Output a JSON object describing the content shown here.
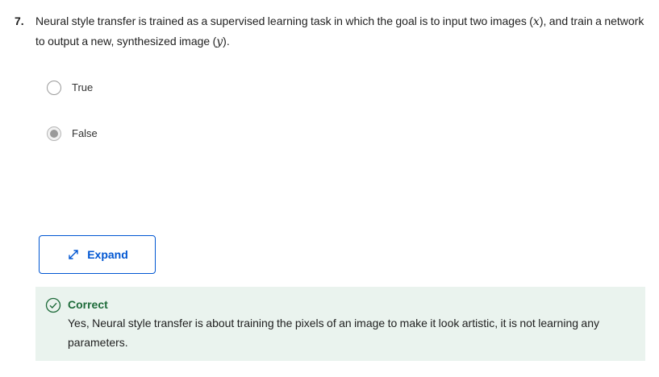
{
  "question": {
    "number": "7.",
    "text_part1": "Neural style transfer is trained as a supervised learning task in which the goal is to input two images (",
    "var_x": "x",
    "text_part2": "), and train a network to output a new, synthesized image (",
    "var_y": "y",
    "text_part3": ")."
  },
  "options": [
    {
      "label": "True",
      "selected": false
    },
    {
      "label": "False",
      "selected": true
    }
  ],
  "expand_button": {
    "label": "Expand",
    "icon": "expand-arrows-icon"
  },
  "feedback": {
    "status": "Correct",
    "icon": "check-circle-icon",
    "message": "Yes, Neural style transfer is about training the pixels of an image to make it look artistic, it is not learning any parameters.",
    "color": "#1e6b3a",
    "background": "#eaf3ee"
  },
  "colors": {
    "accent": "#0056d2"
  }
}
